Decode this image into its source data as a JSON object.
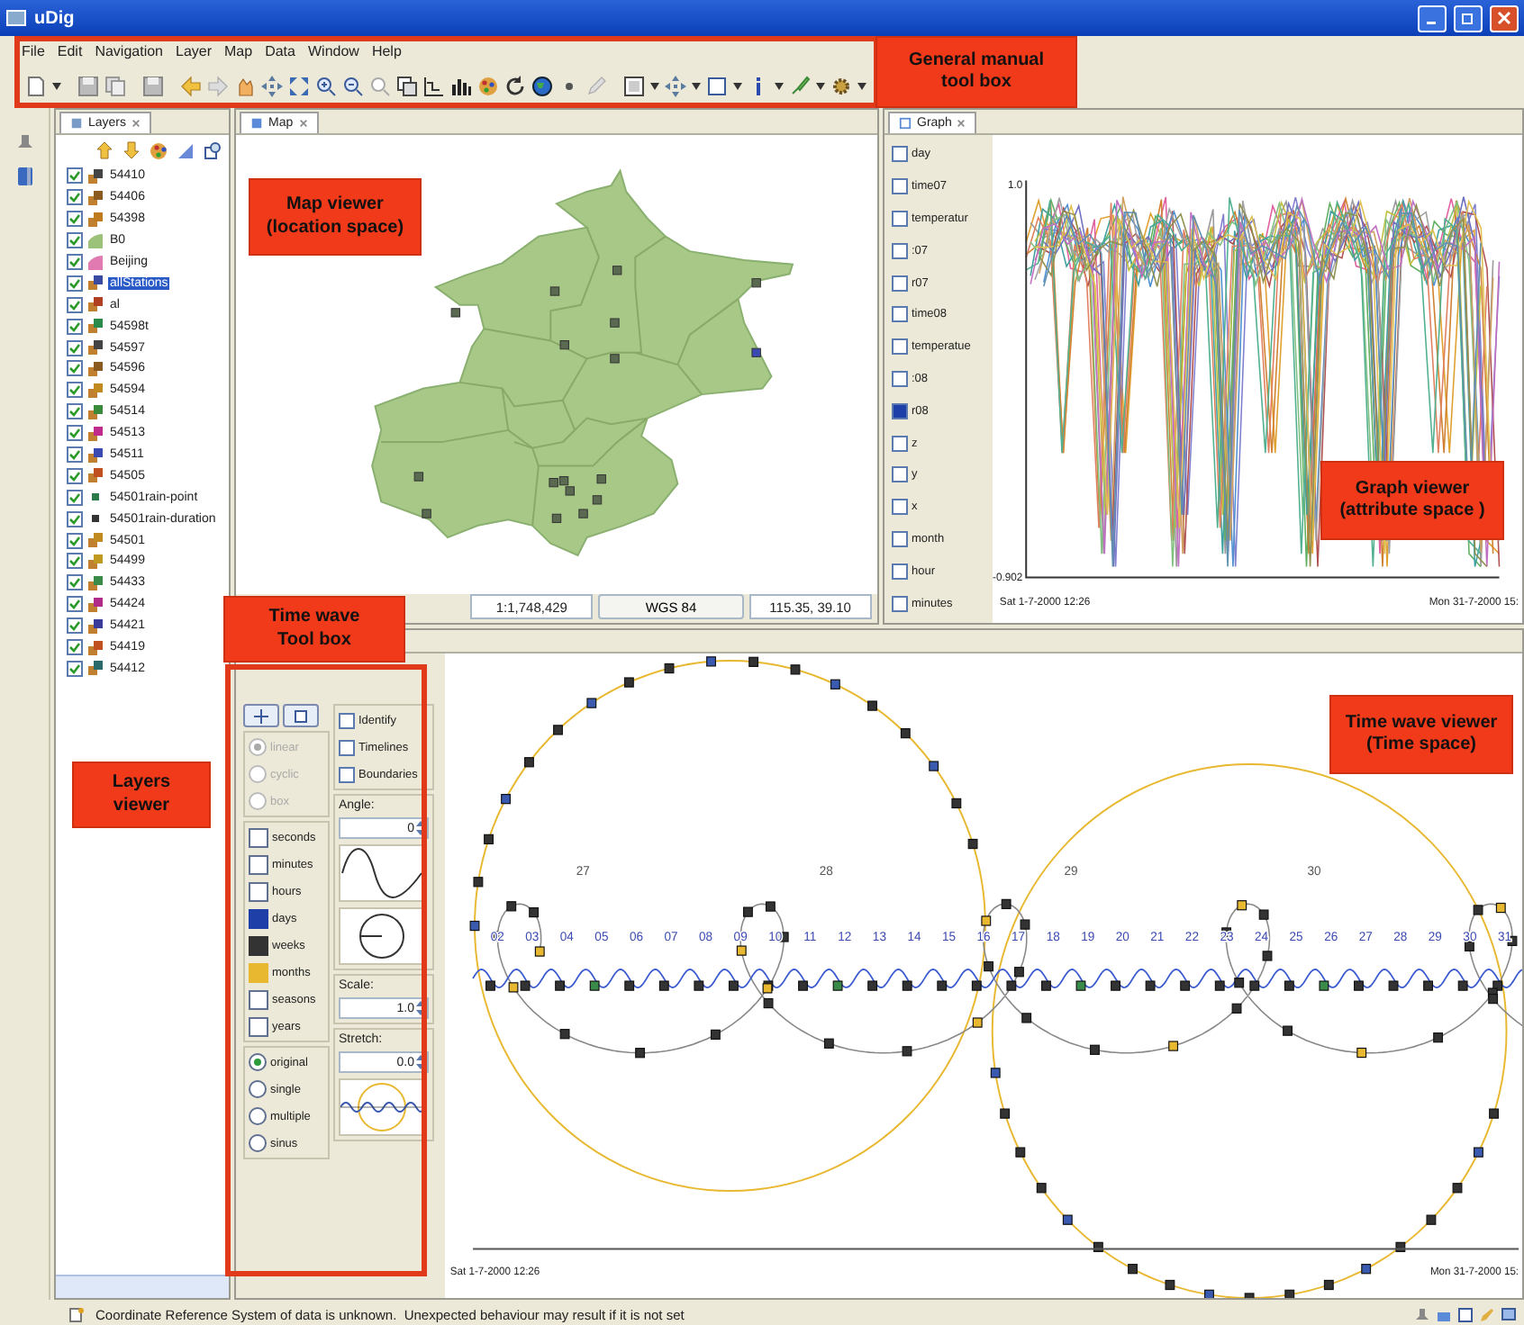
{
  "window": {
    "title": "uDig"
  },
  "menu": [
    "File",
    "Edit",
    "Navigation",
    "Layer",
    "Map",
    "Data",
    "Window",
    "Help"
  ],
  "layers_panel": {
    "tab": "Layers",
    "layers": [
      {
        "name": "54410",
        "checked": true,
        "selected": false,
        "kind": "point",
        "color": "#444444"
      },
      {
        "name": "54406",
        "checked": true,
        "selected": false,
        "kind": "point",
        "color": "#8a5a20"
      },
      {
        "name": "54398",
        "checked": true,
        "selected": false,
        "kind": "point",
        "color": "#c07a20"
      },
      {
        "name": "B0",
        "checked": true,
        "selected": false,
        "kind": "polygon",
        "color": "#9cc27a"
      },
      {
        "name": "Beijing",
        "checked": true,
        "selected": false,
        "kind": "polygon",
        "color": "#e07ab0"
      },
      {
        "name": "allStations",
        "checked": true,
        "selected": true,
        "kind": "point",
        "color": "#3a4aa0"
      },
      {
        "name": "al",
        "checked": true,
        "selected": false,
        "kind": "point",
        "color": "#b04020"
      },
      {
        "name": "54598t",
        "checked": true,
        "selected": false,
        "kind": "point",
        "color": "#2a8a4a"
      },
      {
        "name": "54597",
        "checked": true,
        "selected": false,
        "kind": "point",
        "color": "#444444"
      },
      {
        "name": "54596",
        "checked": true,
        "selected": false,
        "kind": "point",
        "color": "#8a5a20"
      },
      {
        "name": "54594",
        "checked": true,
        "selected": false,
        "kind": "point",
        "color": "#c08a20"
      },
      {
        "name": "54514",
        "checked": true,
        "selected": false,
        "kind": "point",
        "color": "#3a8a3a"
      },
      {
        "name": "54513",
        "checked": true,
        "selected": false,
        "kind": "point",
        "color": "#c02a8a"
      },
      {
        "name": "54511",
        "checked": true,
        "selected": false,
        "kind": "point",
        "color": "#3a4ab0"
      },
      {
        "name": "54505",
        "checked": true,
        "selected": false,
        "kind": "point",
        "color": "#c05020"
      },
      {
        "name": "54501rain-point",
        "checked": true,
        "selected": false,
        "kind": "square",
        "color": "#2a7a4a"
      },
      {
        "name": "54501rain-duration",
        "checked": true,
        "selected": false,
        "kind": "square",
        "color": "#333333"
      },
      {
        "name": "54501",
        "checked": true,
        "selected": false,
        "kind": "point",
        "color": "#c08a20"
      },
      {
        "name": "54499",
        "checked": true,
        "selected": false,
        "kind": "point",
        "color": "#c09a20"
      },
      {
        "name": "54433",
        "checked": true,
        "selected": false,
        "kind": "point",
        "color": "#3a8a4a"
      },
      {
        "name": "54424",
        "checked": true,
        "selected": false,
        "kind": "point",
        "color": "#b02a8a"
      },
      {
        "name": "54421",
        "checked": true,
        "selected": false,
        "kind": "point",
        "color": "#3a3a9a"
      },
      {
        "name": "54419",
        "checked": true,
        "selected": false,
        "kind": "point",
        "color": "#c05020"
      },
      {
        "name": "54412",
        "checked": true,
        "selected": false,
        "kind": "point",
        "color": "#2a6a6a"
      }
    ]
  },
  "map_panel": {
    "tab": "Map",
    "scale": "1:1,748,429",
    "crs": "WGS 84",
    "coordinates": "115.35, 39.10"
  },
  "graph_panel": {
    "tab": "Graph",
    "attributes": [
      {
        "name": "day",
        "checked": false
      },
      {
        "name": "time07",
        "checked": false
      },
      {
        "name": "temperatur",
        "checked": false
      },
      {
        "name": ":07",
        "checked": false
      },
      {
        "name": "r07",
        "checked": false
      },
      {
        "name": "time08",
        "checked": false
      },
      {
        "name": "temperatue",
        "checked": false
      },
      {
        "name": ":08",
        "checked": false
      },
      {
        "name": "r08",
        "checked": true
      },
      {
        "name": "z",
        "checked": false
      },
      {
        "name": "y",
        "checked": false
      },
      {
        "name": "x",
        "checked": false
      },
      {
        "name": "month",
        "checked": false
      },
      {
        "name": "hour",
        "checked": false
      },
      {
        "name": "minutes",
        "checked": false
      }
    ],
    "y_max": "1.0",
    "y_min": "-0.902",
    "x_start": "Sat 1-7-2000 12:26",
    "x_end": "Mon 31-7-2000 15:"
  },
  "time_wave_toolbox": {
    "options": [
      {
        "label": "Identify",
        "checked": false
      },
      {
        "label": "Timelines",
        "checked": false
      },
      {
        "label": "Boundaries",
        "checked": false
      }
    ],
    "shapes": [
      {
        "label": "linear",
        "selected": true,
        "disabled": true
      },
      {
        "label": "cyclic",
        "selected": false,
        "disabled": true
      },
      {
        "label": "box",
        "selected": false,
        "disabled": true
      }
    ],
    "granularities": [
      {
        "label": "seconds",
        "checked": false
      },
      {
        "label": "minutes",
        "checked": false
      },
      {
        "label": "hours",
        "checked": false
      },
      {
        "label": "days",
        "checked": true,
        "color": "#1f3fa8"
      },
      {
        "label": "weeks",
        "checked": true,
        "color": "#333333"
      },
      {
        "label": "months",
        "checked": true,
        "color": "#e8b830"
      },
      {
        "label": "seasons",
        "checked": false
      },
      {
        "label": "years",
        "checked": false
      }
    ],
    "angle": {
      "label": "Angle:",
      "value": "0"
    },
    "scale": {
      "label": "Scale:",
      "value": "1.0"
    },
    "stretch": {
      "label": "Stretch:",
      "value": "0.0"
    },
    "modes": [
      {
        "label": "original",
        "selected": true
      },
      {
        "label": "single",
        "selected": false
      },
      {
        "label": "multiple",
        "selected": false
      },
      {
        "label": "sinus",
        "selected": false
      }
    ]
  },
  "time_wave_viewer": {
    "week_labels": [
      "27",
      "28",
      "29",
      "30"
    ],
    "day_labels": [
      "02",
      "03",
      "04",
      "05",
      "06",
      "07",
      "08",
      "09",
      "10",
      "11",
      "12",
      "13",
      "14",
      "15",
      "16",
      "17",
      "18",
      "19",
      "20",
      "21",
      "22",
      "23",
      "24",
      "25",
      "26",
      "27",
      "28",
      "29",
      "30",
      "31"
    ],
    "x_start": "Sat 1-7-2000 12:26",
    "x_end": "Mon 31-7-2000 15:"
  },
  "status_bar": {
    "message": "Coordinate Reference System of data is unknown.  Unexpected behaviour may result if it is not set"
  },
  "annotations": [
    {
      "lines": [
        "General manual",
        "tool box"
      ]
    },
    {
      "lines": [
        "Map viewer",
        "(location space)"
      ]
    },
    {
      "lines": [
        "Graph viewer",
        "(attribute space )"
      ]
    },
    {
      "lines": [
        "Time wave",
        "Tool box"
      ]
    },
    {
      "lines": [
        "Layers",
        "viewer"
      ]
    },
    {
      "lines": [
        "Time wave viewer",
        "(Time space)"
      ]
    }
  ]
}
